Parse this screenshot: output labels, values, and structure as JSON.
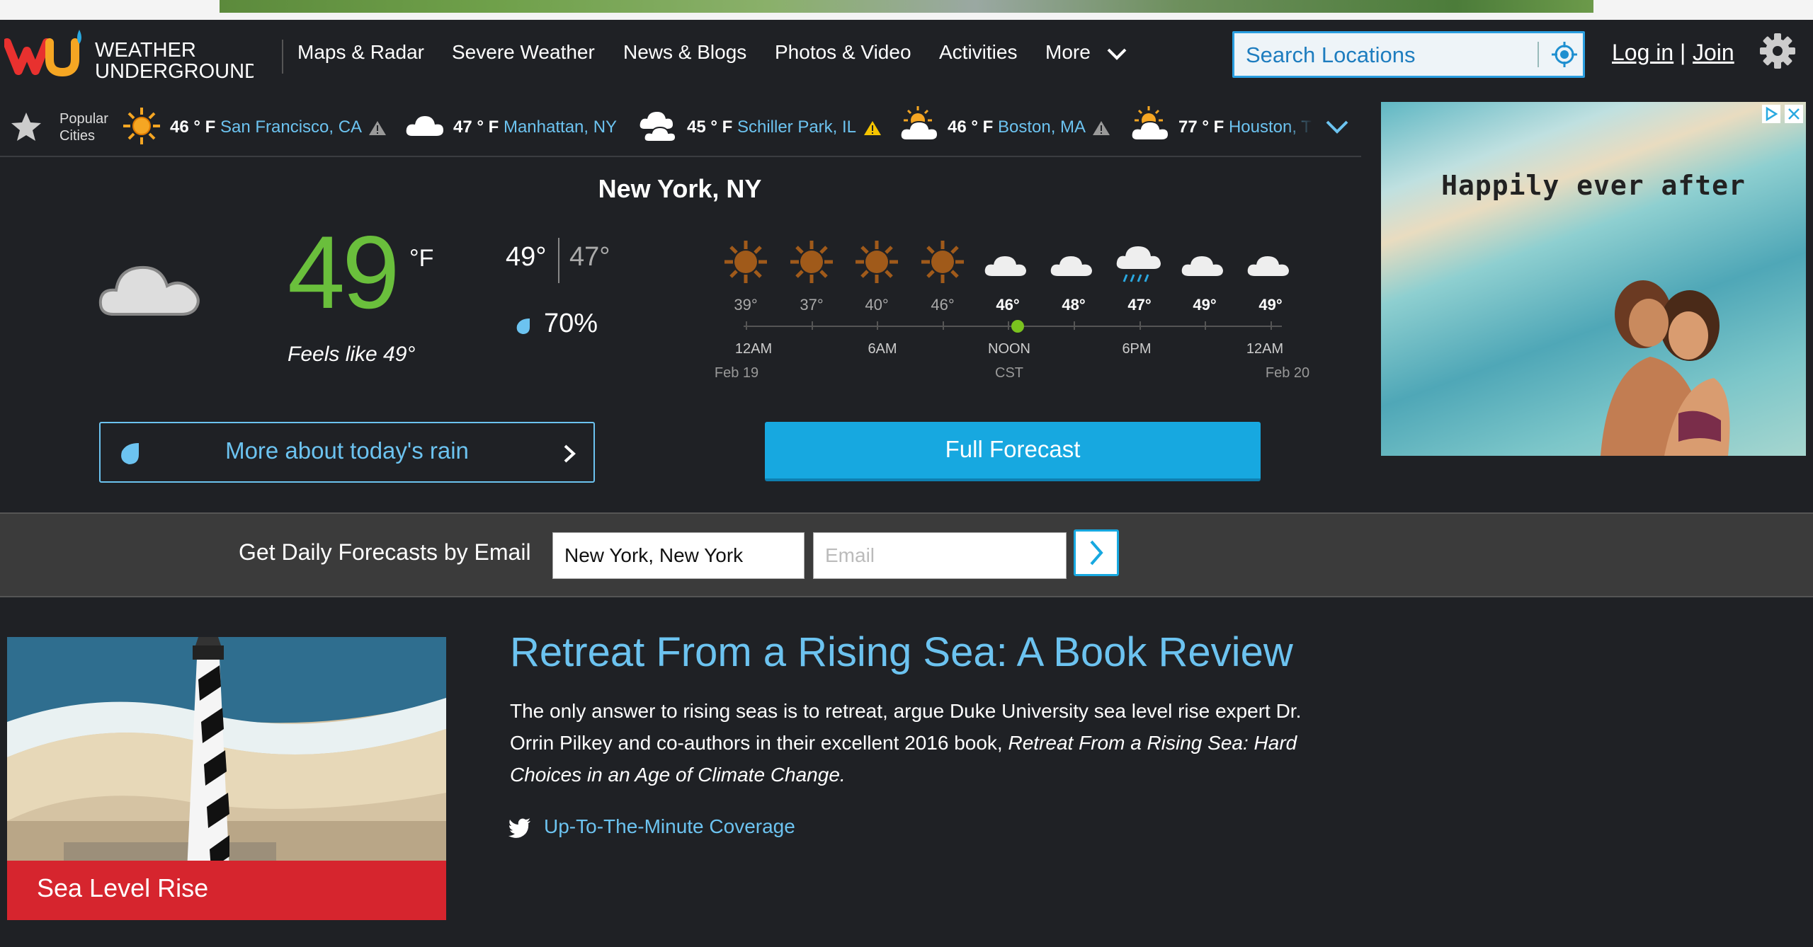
{
  "logo": {
    "line1": "WEATHER",
    "line2": "UNDERGROUND"
  },
  "nav": {
    "items": [
      "Maps & Radar",
      "Severe Weather",
      "News & Blogs",
      "Photos & Video",
      "Activities",
      "More"
    ],
    "search_placeholder": "Search Locations",
    "login": "Log in",
    "sep": "|",
    "join": "Join"
  },
  "popular": {
    "label": "Popular Cities",
    "cities": [
      {
        "temp": "46 ° F",
        "name": "San Francisco, CA",
        "icon": "sunny-icon",
        "alert": true
      },
      {
        "temp": "47 ° F",
        "name": "Manhattan, NY",
        "icon": "cloudy-icon",
        "alert": false
      },
      {
        "temp": "45 ° F",
        "name": "Schiller Park, IL",
        "icon": "mostly-cloudy-icon",
        "alert": true
      },
      {
        "temp": "46 ° F",
        "name": "Boston, MA",
        "icon": "partly-cloudy-icon",
        "alert": true
      },
      {
        "temp": "77 ° F",
        "name": "Houston, TX",
        "icon": "partly-cloudy-icon",
        "alert": false
      }
    ]
  },
  "current": {
    "city": "New York, NY",
    "temp": "49",
    "unit": "°F",
    "feels": "Feels like 49°",
    "hi": "49°",
    "lo": "47°",
    "precip": "70%"
  },
  "hourly": {
    "temps": [
      "39°",
      "37°",
      "40°",
      "46°",
      "46°",
      "48°",
      "47°",
      "49°",
      "49°"
    ],
    "icons": [
      "sun-icon",
      "sun-icon",
      "sun-icon",
      "sun-icon",
      "cloud-icon",
      "cloud-icon",
      "rain-icon",
      "cloud-icon",
      "cloud-icon"
    ],
    "labels": [
      "12AM",
      "6AM",
      "NOON",
      "6PM",
      "12AM"
    ],
    "sublabels": [
      "Feb 19",
      "CST",
      "Feb 20"
    ]
  },
  "buttons": {
    "rain": "More about today's rain",
    "forecast": "Full Forecast"
  },
  "ad": {
    "text": "Happily ever after"
  },
  "email": {
    "label": "Get Daily Forecasts by Email",
    "location_value": "New York, New York",
    "email_placeholder": "Email"
  },
  "article": {
    "tag": "Sea Level Rise",
    "title": "Retreat From a Rising Sea: A Book Review",
    "body_plain": "The only answer to rising seas is to retreat, argue Duke University sea level rise expert Dr. Orrin Pilkey and co-authors in their excellent 2016 book, ",
    "body_italic": "Retreat From a Rising Sea: Hard Choices in an Age of Climate Change.",
    "link": "Up-To-The-Minute Coverage"
  },
  "colors": {
    "accent": "#6cc3f0",
    "temp_green": "#6abf3c",
    "button_blue": "#17a8e0",
    "tag_red": "#d6252e"
  }
}
